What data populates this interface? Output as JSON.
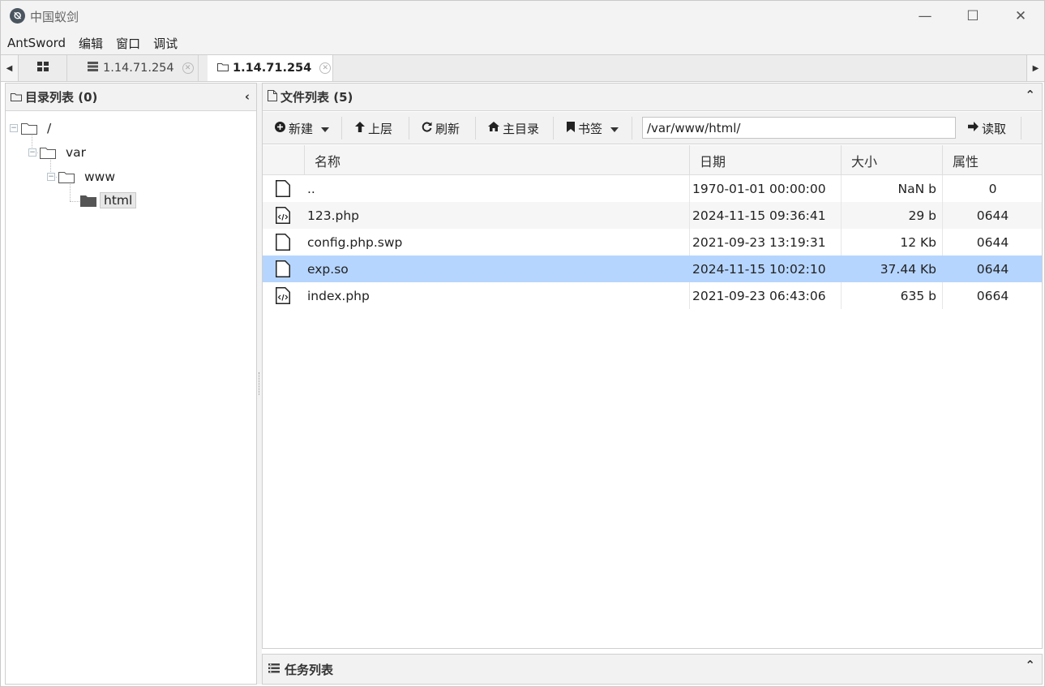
{
  "window": {
    "title": "中国蚁剑",
    "logo_glyph": "⦰",
    "minimize": "—",
    "maximize": "☐",
    "close": "✕"
  },
  "menu": [
    "AntSword",
    "编辑",
    "窗口",
    "调试"
  ],
  "tabs": {
    "left_arrow": "◀",
    "right_arrow": "▶",
    "home_icon": "grid-icon",
    "items": [
      {
        "icon": "server-icon",
        "label": "1.14.71.254",
        "active": false
      },
      {
        "icon": "folder-icon",
        "label": "1.14.71.254",
        "active": true
      }
    ],
    "close_glyph": "✕"
  },
  "directory_panel": {
    "title": "目录列表 (0)",
    "collapse_glyph": "‹",
    "tree": [
      {
        "label": "/",
        "toggle": "−"
      },
      {
        "label": "var",
        "toggle": "−"
      },
      {
        "label": "www",
        "toggle": "−"
      },
      {
        "label": "html",
        "selected": true
      }
    ]
  },
  "file_panel": {
    "title": "文件列表 (5)",
    "collapse_glyph": "⌃",
    "toolbar": {
      "new": "新建",
      "up": "上层",
      "refresh": "刷新",
      "home": "主目录",
      "bookmark": "书签",
      "path": "/var/www/html/",
      "read": "读取"
    },
    "columns": [
      "名称",
      "日期",
      "大小",
      "属性"
    ],
    "files": [
      {
        "name": "..",
        "date": "1970-01-01 00:00:00",
        "size": "NaN b",
        "perm": "0",
        "icon": "file-icon"
      },
      {
        "name": "123.php",
        "date": "2024-11-15 09:36:41",
        "size": "29 b",
        "perm": "0644",
        "icon": "code-file-icon"
      },
      {
        "name": "config.php.swp",
        "date": "2021-09-23 13:19:31",
        "size": "12 Kb",
        "perm": "0644",
        "icon": "file-icon"
      },
      {
        "name": "exp.so",
        "date": "2024-11-15 10:02:10",
        "size": "37.44 Kb",
        "perm": "0644",
        "icon": "file-icon",
        "selected": true
      },
      {
        "name": "index.php",
        "date": "2021-09-23 06:43:06",
        "size": "635 b",
        "perm": "0664",
        "icon": "code-file-icon"
      }
    ]
  },
  "task_panel": {
    "title": "任务列表",
    "collapse_glyph": "⌃"
  }
}
